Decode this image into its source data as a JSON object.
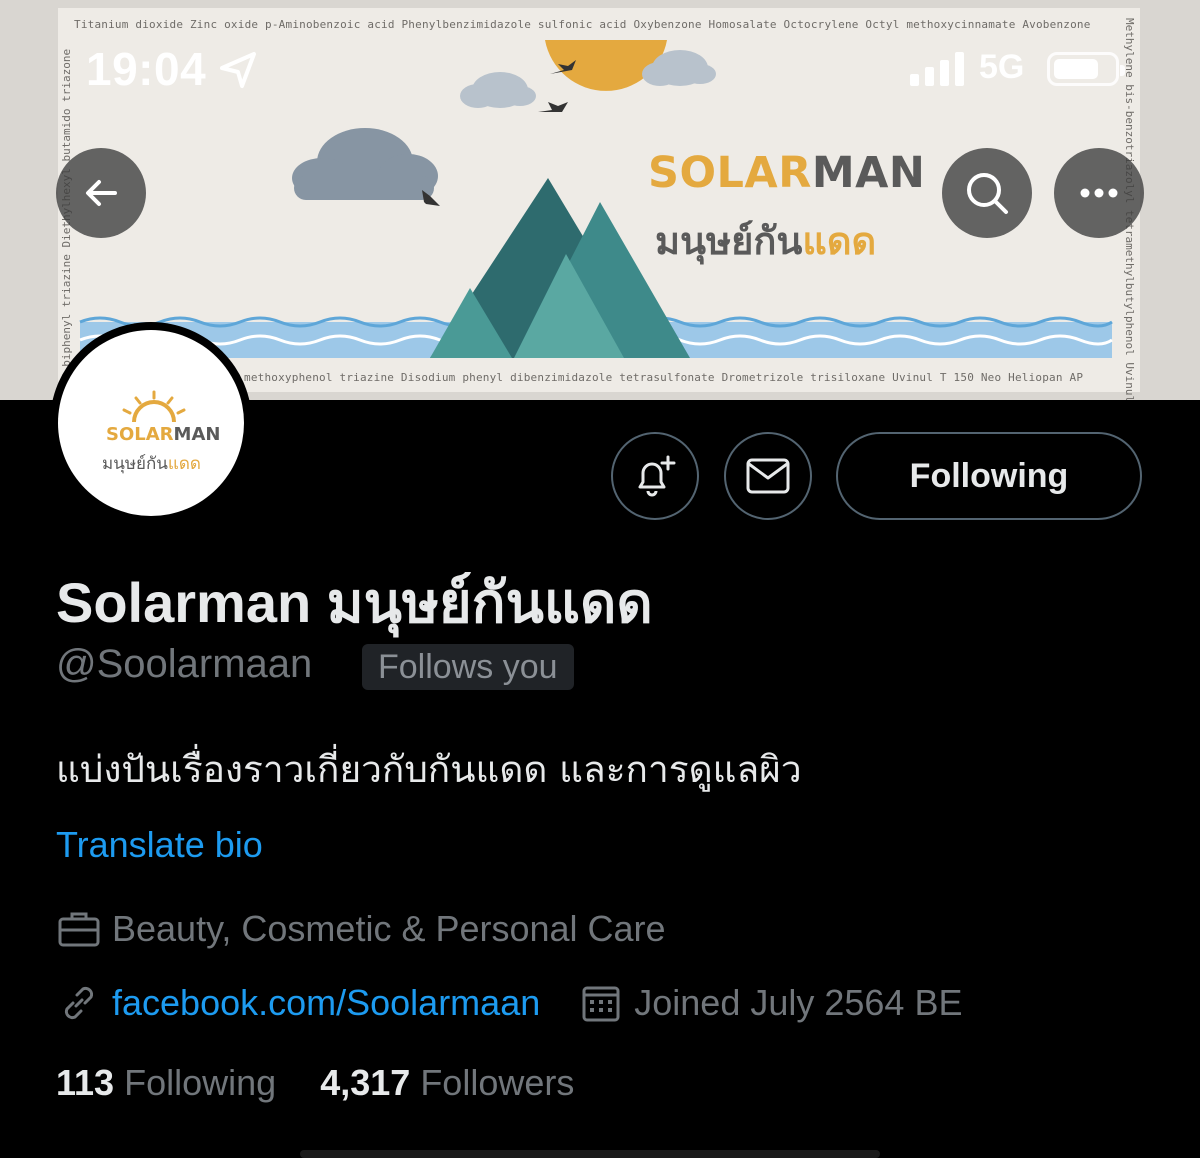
{
  "status_bar": {
    "time": "19:04",
    "network": "5G",
    "location_icon": "location-arrow-icon",
    "signal_icon": "signal-bars-icon",
    "battery_icon": "battery-icon"
  },
  "banner": {
    "chem_top": "Titanium dioxide Zinc oxide p-Aminobenzoic acid Phenylbenzimidazole sulfonic acid Oxybenzone Homosalate Octocrylene Octyl methoxycinnamate Avobenzone",
    "chem_bottom": "methoxyphenol triazine  Disodium phenyl dibenzimidazole tetrasulfonate  Drometrizole trisiloxane Uvinul T 150 Neo Heliopan AP",
    "chem_left": "s-biphenyl triazine Diethylhexyl butamido triazone",
    "chem_right": "Methylene bis-benzotriazolyl tetramethylbutylphenol Uvinul",
    "brand_solar": "SOLAR",
    "brand_man": "MAN",
    "brand_thai_a": "มนุษย์กัน",
    "brand_thai_b": "แดด"
  },
  "nav": {
    "back_icon": "arrow-left-icon",
    "search_icon": "search-icon",
    "more_icon": "more-dots-icon"
  },
  "avatar": {
    "solar": "SOLAR",
    "man": "MAN",
    "thai_a": "มนุษย์กัน",
    "thai_b": "แดด"
  },
  "actions": {
    "notify_icon": "bell-plus-icon",
    "message_icon": "envelope-icon",
    "following_label": "Following"
  },
  "profile": {
    "name": "Solarman มนุษย์กันแดด",
    "handle": "@Soolarmaan",
    "follows_you": "Follows you",
    "bio": "แบ่งปันเรื่องราวเกี่ยวกับกันแดด และการดูแลผิว",
    "translate": "Translate bio",
    "category": "Beauty, Cosmetic & Personal Care",
    "website": "facebook.com/Soolarmaan",
    "joined": "Joined July 2564 BE",
    "following_count": "113",
    "following_label": "Following",
    "followers_count": "4,317",
    "followers_label": "Followers"
  },
  "colors": {
    "accent": "#1d9bf0",
    "muted": "#71767b",
    "brand_yellow": "#e4a93f",
    "background": "#000000"
  }
}
